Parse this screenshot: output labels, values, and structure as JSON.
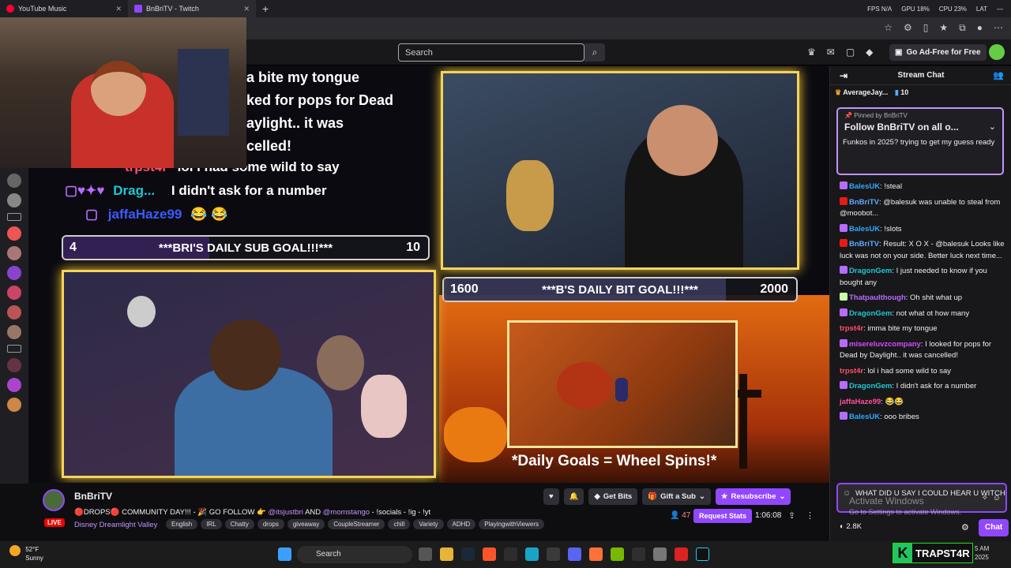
{
  "browser": {
    "tabs": [
      {
        "label": "YouTube Music",
        "color": "#ff0033"
      },
      {
        "label": "BnBriTV - Twitch",
        "color": "#9147ff"
      }
    ],
    "perf": {
      "fps": "FPS N/A",
      "gpu": "GPU 18%",
      "cpu": "CPU 23%",
      "lat": "LAT"
    }
  },
  "twitch_header": {
    "search_placeholder": "Search",
    "ad_free": "Go Ad-Free for Free"
  },
  "stream_overlay": {
    "chat_lines": [
      "a bite my tongue",
      "ked for pops for Dead",
      "aylight.. it was",
      "celled!"
    ],
    "line_trp_user": "trpst4r",
    "line_trp_text": "lol i had some wild to say",
    "line_drag_user": "Drag...",
    "line_drag_text": "I didn't ask for a number",
    "line_jaffa_user": "jaffaHaze99",
    "line_jaffa_text": "😂 😂",
    "sub_goal": {
      "current": "4",
      "label": "***BRI'S DAILY SUB GOAL!!!***",
      "max": "10",
      "progress": 0.4
    },
    "bit_goal": {
      "current": "1600",
      "label": "***B'S DAILY BIT GOAL!!!***",
      "max": "2000",
      "progress": 0.8
    },
    "wheel_text": "*Daily Goals = Wheel Spins!*"
  },
  "channel": {
    "name": "BnBriTV",
    "live": "LIVE",
    "title_a": "🔴DROPS🔴 COMMUNITY DAY!!! - 🎉 GO FOLLOW 👉",
    "title_h1": "@itsjustbri",
    "title_b": "AND",
    "title_h2": "@momstango",
    "title_c": "- !socials - !ig - !yt",
    "game": "Disney Dreamlight Valley",
    "tags": [
      "English",
      "IRL",
      "Chatty",
      "drops",
      "giveaway",
      "CoupleStreamer",
      "chill",
      "Variety",
      "ADHD",
      "PlayingwithViewers"
    ],
    "get_bits": "Get Bits",
    "gift_sub": "Gift a Sub",
    "resubscribe": "Resubscribe",
    "viewers": "47",
    "request_stats": "Request Stats",
    "uptime": "1:06:08"
  },
  "chat": {
    "title": "Stream Chat",
    "hype_user": "AverageJay...",
    "hype_count": "10",
    "pinned_by": "Pinned by",
    "pinned_by_user": "BnBriTV",
    "pinned_text": "Follow BnBriTV on all o...",
    "pinned_sub": "Funkos in 2025? trying to get my guess ready",
    "messages": [
      {
        "user": "BalesUK",
        "color": "#2fa8ff",
        "text": "!steal"
      },
      {
        "user": "BnBriTV",
        "color": "#5eaaff",
        "text": "@balesuk was unable to steal from @moobot..."
      },
      {
        "user": "BalesUK",
        "color": "#2fa8ff",
        "text": "!slots"
      },
      {
        "user": "BnBriTV",
        "color": "#5eaaff",
        "text": "Result: X O X - @balesuk Looks like luck was not on your side. Better luck next time..."
      },
      {
        "user": "DragonGem",
        "color": "#1ec8d2",
        "text": "I just needed to know if you bought any"
      },
      {
        "user": "Thatpaulthough",
        "color": "#b86bff",
        "text": "Oh shit what up"
      },
      {
        "user": "DragonGem",
        "color": "#1ec8d2",
        "text": "not what ot how many"
      },
      {
        "user": "trpst4r",
        "color": "#ff4f6a",
        "text": "imma bite my tongue"
      },
      {
        "user": "misereluvzcompany",
        "color": "#d44bff",
        "text": "I looked for pops for Dead by Daylight.. it was cancelled!"
      },
      {
        "user": "trpst4r",
        "color": "#ff4f6a",
        "text": "lol i had some wild to say"
      },
      {
        "user": "DragonGem",
        "color": "#1ec8d2",
        "text": "I didn't ask for a number"
      },
      {
        "user": "jaffaHaze99",
        "color": "#ff4f9a",
        "text": "😂😂"
      },
      {
        "user": "BalesUK",
        "color": "#2fa8ff",
        "text": "ooo bribes"
      }
    ],
    "input_value": "WHAT DID U SAY I COULD HEAR U WITCH",
    "activate_1": "Activate Windows",
    "activate_2": "Go to Settings to activate Windows.",
    "points": "2.8K",
    "chat_button": "Chat"
  },
  "taskbar": {
    "temp": "52°F",
    "cond": "Sunny",
    "search": "Search",
    "time": "5 AM",
    "date": "2025"
  },
  "brand": {
    "k": "K",
    "name": "TRAPST4R"
  }
}
